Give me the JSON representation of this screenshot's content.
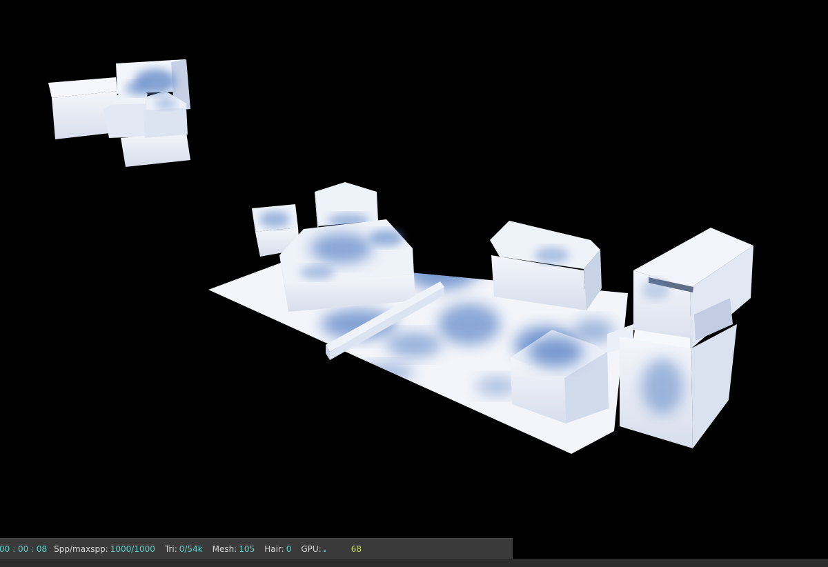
{
  "statusbar": {
    "time": "00 : 00 : 08",
    "spp_label": "Spp/maxspp:",
    "spp_value": "1000/1000",
    "tri_label": "Tri:",
    "tri_value": "0/54k",
    "mesh_label": "Mesh:",
    "mesh_value": "105",
    "hair_label": "Hair:",
    "hair_value": "0",
    "gpu_label": "GPU:",
    "gpu_value": "68",
    "gpu_load": 0.1
  },
  "colors": {
    "background": "#000000",
    "statusbar_bg": "#3a3a3a",
    "value_text": "#5fd1c8",
    "gpu_text": "#c8d86a",
    "model_white": "#f2f5fb",
    "shadow_blue": "#5f86c7"
  }
}
